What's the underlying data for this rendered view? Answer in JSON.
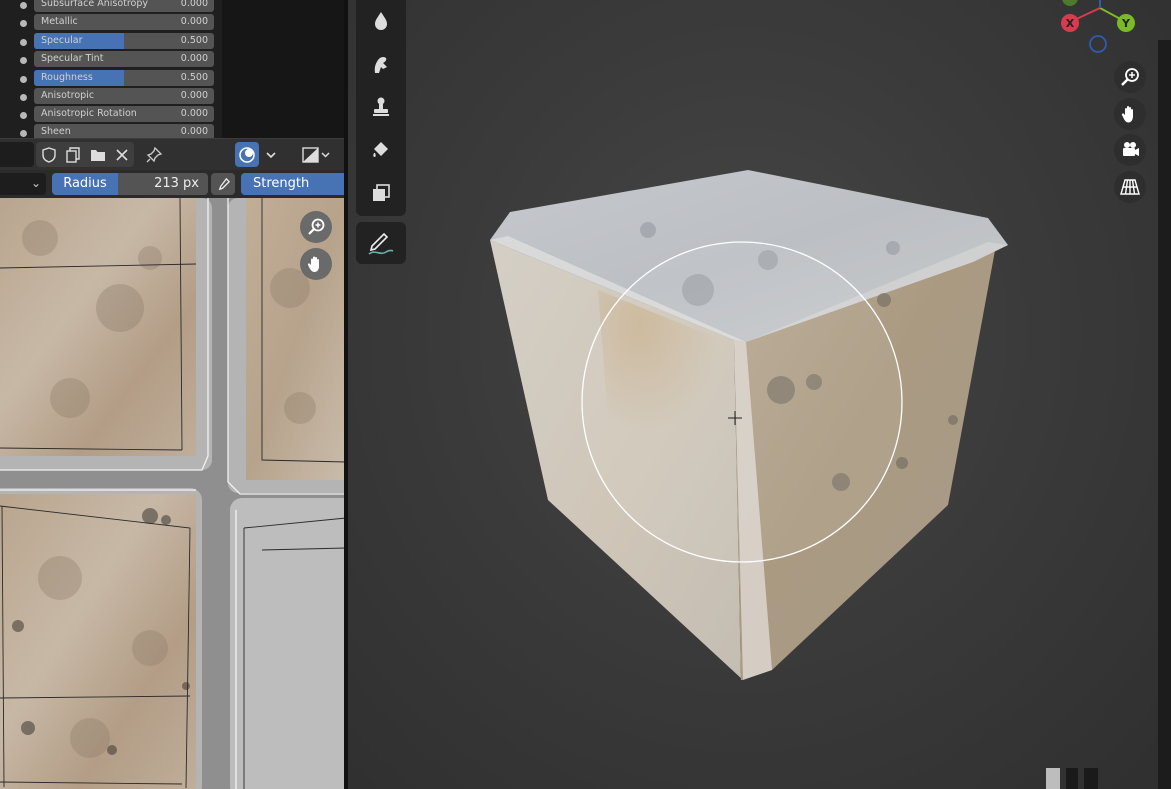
{
  "properties": {
    "rows": [
      {
        "label": "Subsurface Anisotropy",
        "value": "0.000",
        "fill": 0
      },
      {
        "label": "Metallic",
        "value": "0.000",
        "fill": 0
      },
      {
        "label": "Specular",
        "value": "0.500",
        "fill": 0.5
      },
      {
        "label": "Specular Tint",
        "value": "0.000",
        "fill": 0
      },
      {
        "label": "Roughness",
        "value": "0.500",
        "fill": 0.5
      },
      {
        "label": "Anisotropic",
        "value": "0.000",
        "fill": 0
      },
      {
        "label": "Anisotropic Rotation",
        "value": "0.000",
        "fill": 0
      },
      {
        "label": "Sheen",
        "value": "0.000",
        "fill": 0
      }
    ]
  },
  "tool_settings": {
    "radius_label": "Radius",
    "radius_value": "213 px",
    "strength_label": "Strength"
  },
  "axis_gizmo": {
    "x_label": "X",
    "y_label": "Y"
  },
  "colors": {
    "accent": "#4772b3",
    "axis_x": "#d83a4e",
    "axis_y": "#7cb926",
    "axis_z": "#2f5bb0"
  },
  "icons": {
    "image_editor_header": [
      "shield-icon",
      "duplicate-icon",
      "folder-icon",
      "close-icon",
      "pin-icon",
      "overlay-icon",
      "chevron-down-icon",
      "display-channels-icon"
    ],
    "paint_toolbar": [
      "soften-drop-icon",
      "smear-icon",
      "clone-stamp-icon",
      "fill-bucket-icon",
      "mask-icon",
      "draw-brush-icon"
    ],
    "viewport_nav": [
      "zoom-icon",
      "hand-pan-icon",
      "camera-icon",
      "grid-perspective-icon"
    ]
  }
}
